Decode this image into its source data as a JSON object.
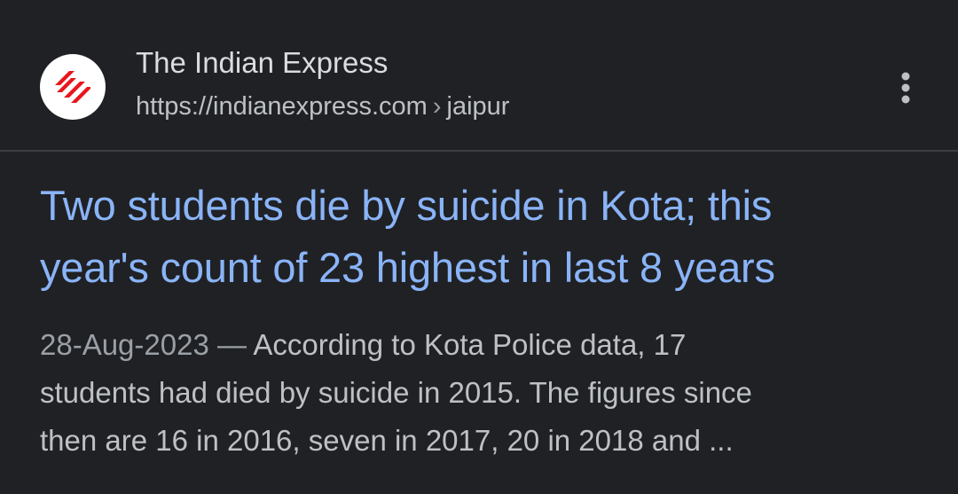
{
  "result": {
    "favicon": {
      "icon": "indian-express-logo-icon",
      "accent": "#e8161d"
    },
    "site_name": "The Indian Express",
    "url": {
      "domain": "https://indianexpress.com",
      "separator": "›",
      "path": "jaipur"
    },
    "more_icon": "more-vert-icon",
    "title_line1": "Two students die by suicide in Kota; this",
    "title_line2": "year's count of 23 highest in last 8 years",
    "snippet": {
      "date": "28-Aug-2023",
      "dash": " — ",
      "line1": "According to Kota Police data, 17",
      "line2": "students had died by suicide in 2015. The figures since",
      "line3": "then are 16 in 2016, seven in 2017, 20 in 2018 and ..."
    }
  },
  "colors": {
    "background": "#202124",
    "title": "#8ab4f8",
    "site_name": "#dadce0",
    "url": "#bdc1c6",
    "snippet": "#bdc1c6",
    "date": "#9aa0a6"
  }
}
